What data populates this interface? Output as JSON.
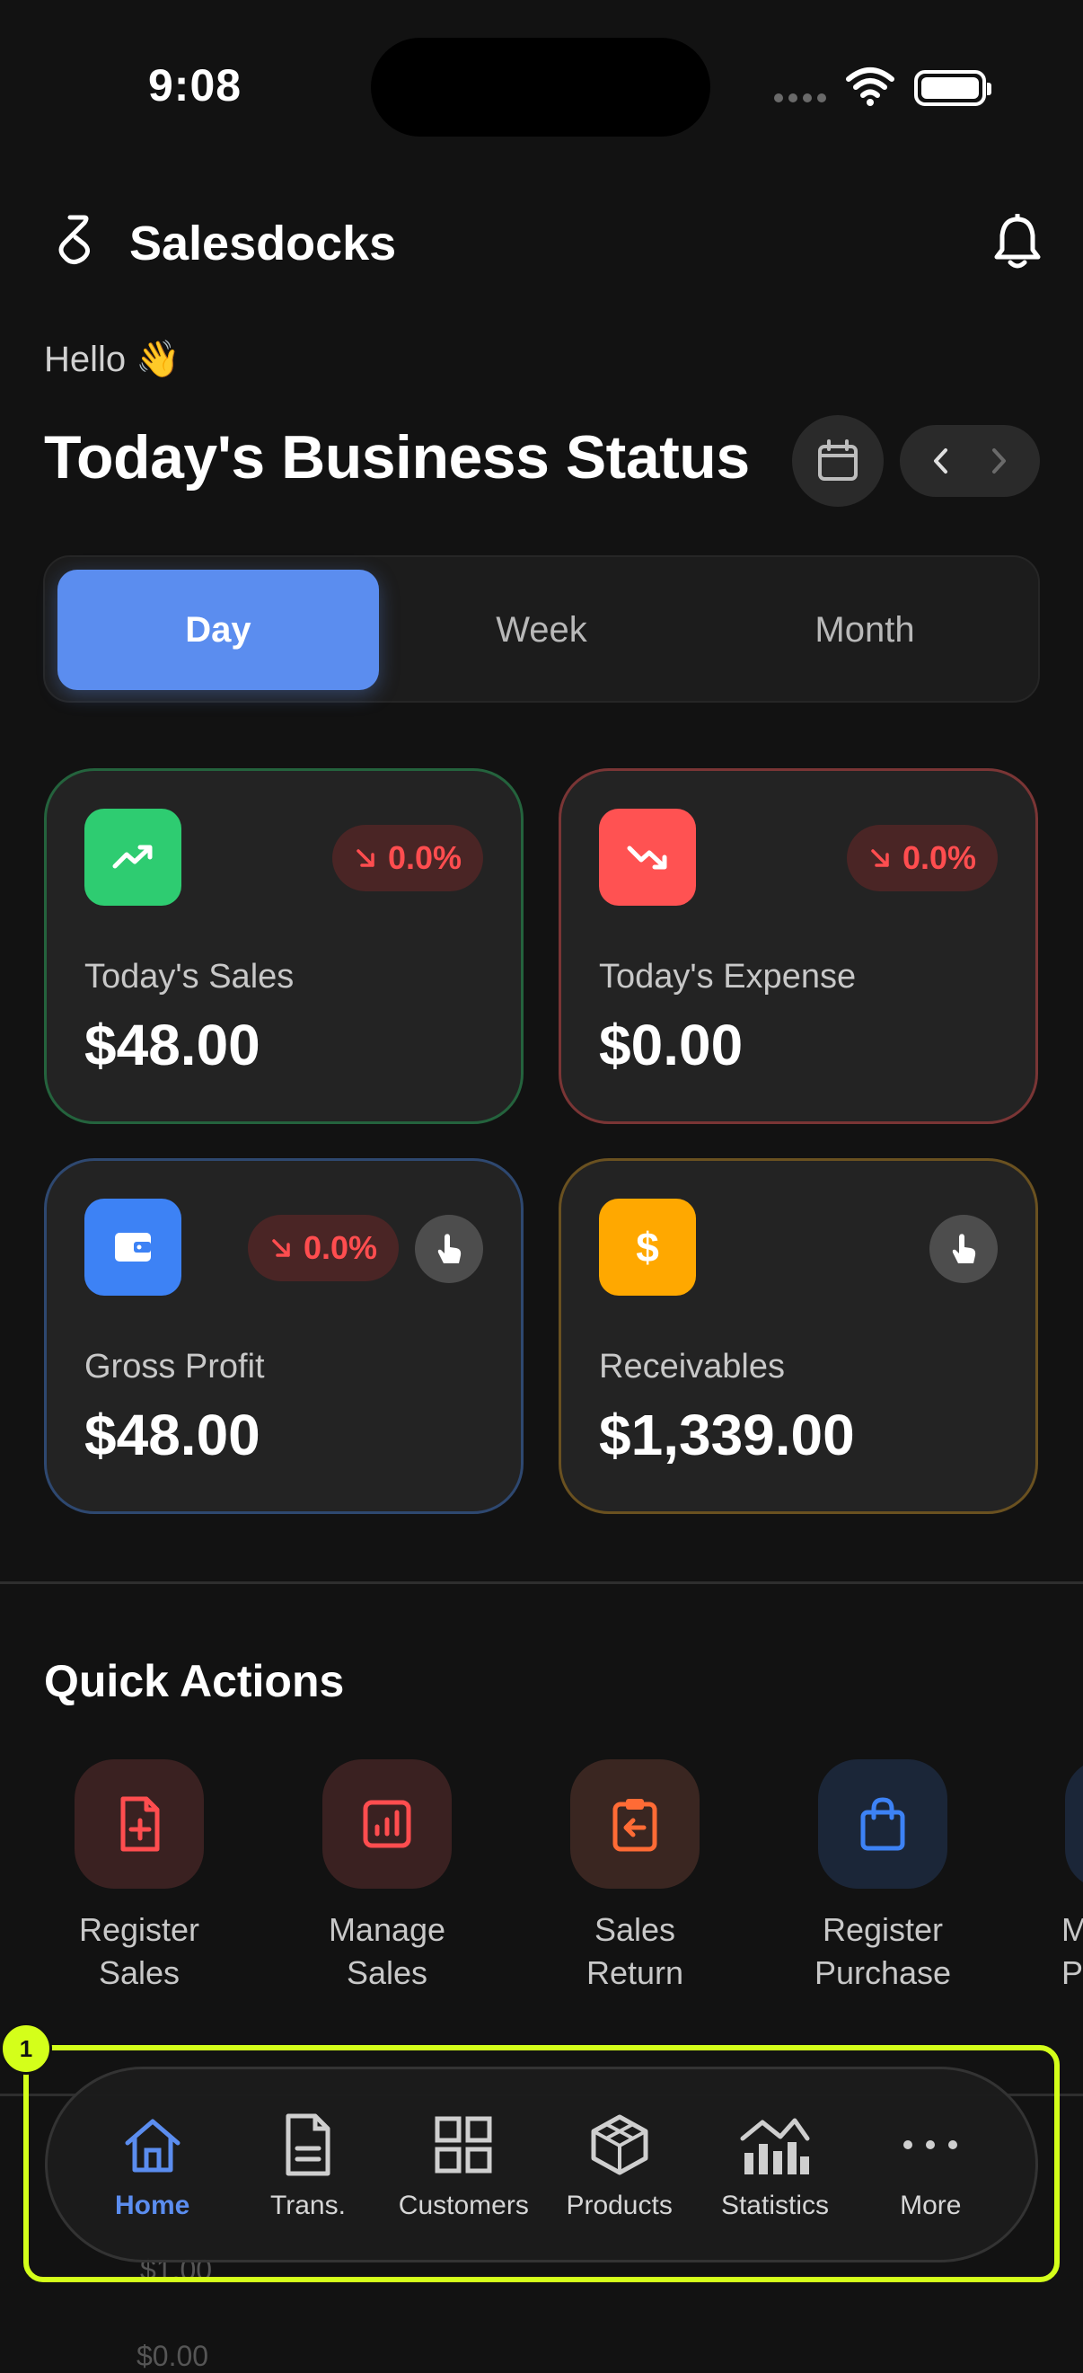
{
  "status_bar": {
    "time": "9:08"
  },
  "header": {
    "brand": "Salesdocks"
  },
  "greeting": "Hello 👋",
  "title": "Today's Business Status",
  "period_tabs": [
    {
      "label": "Day",
      "active": true
    },
    {
      "label": "Week",
      "active": false
    },
    {
      "label": "Month",
      "active": false
    }
  ],
  "cards": {
    "sales": {
      "label": "Today's Sales",
      "value": "$48.00",
      "change": "0.0%",
      "color": "#2ecc71"
    },
    "expense": {
      "label": "Today's Expense",
      "value": "$0.00",
      "change": "0.0%",
      "color": "#ff5252"
    },
    "profit": {
      "label": "Gross Profit",
      "value": "$48.00",
      "change": "0.0%",
      "color": "#3d82f5"
    },
    "receivables": {
      "label": "Receivables",
      "value": "$1,339.00",
      "color": "#ffa800"
    }
  },
  "quick_actions": {
    "title": "Quick Actions",
    "items": [
      {
        "label_line1": "Register",
        "label_line2": "Sales",
        "icon": "file-plus-icon"
      },
      {
        "label_line1": "Manage",
        "label_line2": "Sales",
        "icon": "report-icon"
      },
      {
        "label_line1": "Sales",
        "label_line2": "Return",
        "icon": "clipboard-return-icon"
      },
      {
        "label_line1": "Register",
        "label_line2": "Purchase",
        "icon": "shopping-bag-icon"
      },
      {
        "label_line1": "M",
        "label_line2": "Pu",
        "icon": "partial-icon"
      }
    ]
  },
  "background": {
    "amount1": "$1.00",
    "amount2": "$0.00"
  },
  "tabbar": {
    "badge": "1",
    "items": [
      {
        "label": "Home",
        "active": true
      },
      {
        "label": "Trans.",
        "active": false
      },
      {
        "label": "Customers",
        "active": false
      },
      {
        "label": "Products",
        "active": false
      },
      {
        "label": "Statistics",
        "active": false
      },
      {
        "label": "More",
        "active": false
      }
    ]
  }
}
